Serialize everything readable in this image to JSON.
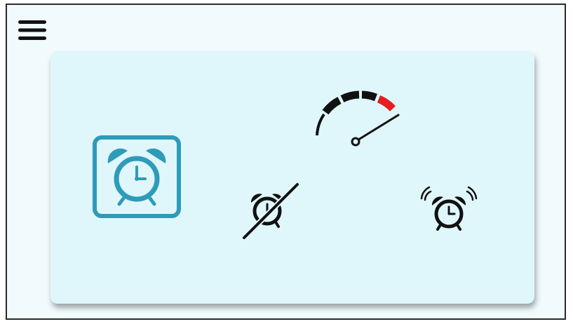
{
  "colors": {
    "accent": "#2e9bb9",
    "panel_bg": "#dff7fb",
    "screen_bg": "#f1fbfd",
    "gauge_dark": "#111111",
    "gauge_red": "#e51c23",
    "icon_dark": "#111111"
  },
  "icons": {
    "menu": "hamburger-menu-icon",
    "alarm_selected": "alarm-clock-icon",
    "speed": "speedometer-icon",
    "alarm_off": "alarm-off-icon",
    "alarm_ring": "alarm-ringing-icon"
  },
  "alarm_tile": {
    "selected": true
  },
  "speed_gauge": {
    "segments": 5,
    "level": 5
  }
}
